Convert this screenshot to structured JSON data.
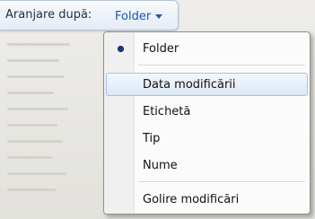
{
  "toolbar": {
    "label": "Aranjare după:",
    "button_label": "Folder"
  },
  "menu": {
    "items": [
      {
        "label": "Folder",
        "selected": true
      },
      {
        "label": "Data modificării",
        "hovered": true
      },
      {
        "label": "Etichetă"
      },
      {
        "label": "Tip"
      },
      {
        "label": "Nume"
      },
      {
        "label": "Golire modificări"
      }
    ]
  },
  "colors": {
    "link_blue": "#1a56b6",
    "bullet": "#1d3b78",
    "hover_border": "#a7c2e6"
  }
}
